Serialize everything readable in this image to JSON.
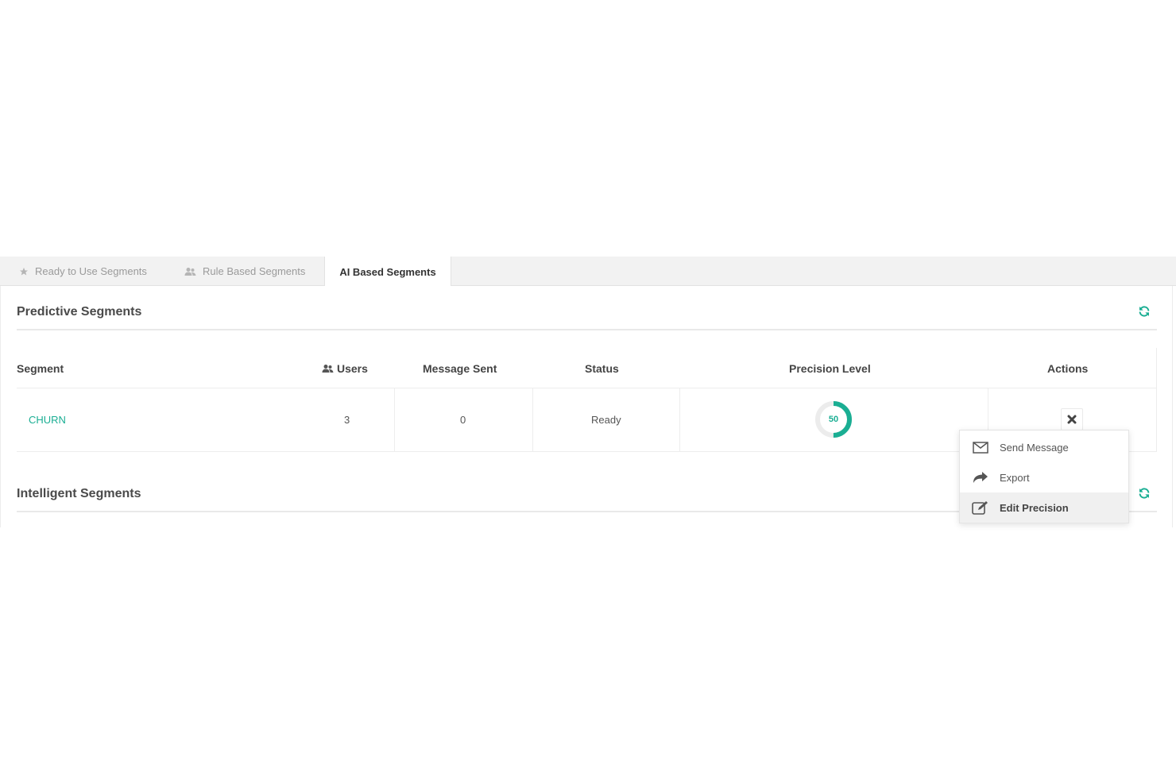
{
  "tabs": {
    "ready": "Ready to Use Segments",
    "rule": "Rule Based Segments",
    "ai": "AI Based Segments"
  },
  "predictive": {
    "title": "Predictive Segments",
    "columns": {
      "segment": "Segment",
      "users": "Users",
      "message_sent": "Message Sent",
      "status": "Status",
      "precision": "Precision Level",
      "actions": "Actions"
    },
    "rows": [
      {
        "segment": "CHURN",
        "users": "3",
        "message_sent": "0",
        "status": "Ready",
        "precision": "50"
      }
    ]
  },
  "intelligent": {
    "title": "Intelligent Segments"
  },
  "actions_menu": {
    "send": "Send Message",
    "export": "Export",
    "edit": "Edit Precision"
  },
  "precision_fill_percent": 50,
  "colors": {
    "accent": "#1aae93",
    "track": "#ececec"
  },
  "icons": [
    "star-icon",
    "users-icon",
    "refresh-icon",
    "close-icon",
    "envelope-icon",
    "share-icon",
    "edit-icon"
  ]
}
